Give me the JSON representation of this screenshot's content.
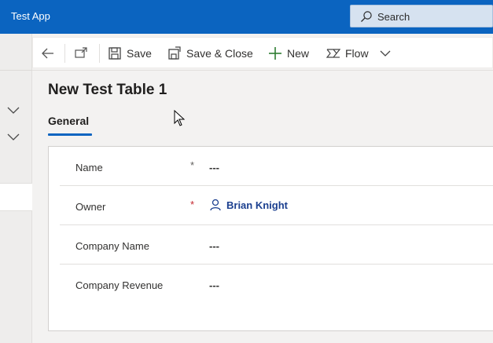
{
  "app": {
    "title": "Test App"
  },
  "search": {
    "label": "Search"
  },
  "commands": {
    "save": "Save",
    "save_close": "Save & Close",
    "new": "New",
    "flow": "Flow"
  },
  "form": {
    "title": "New Test Table 1",
    "tabs": [
      {
        "label": "General"
      }
    ],
    "fields": [
      {
        "label": "Name",
        "required_marker": "*",
        "value": "---"
      },
      {
        "label": "Owner",
        "required_marker": "*",
        "value": "Brian Knight"
      },
      {
        "label": "Company Name",
        "required_marker": "",
        "value": "---"
      },
      {
        "label": "Company Revenue",
        "required_marker": "",
        "value": "---"
      }
    ]
  },
  "colors": {
    "brand": "#0b64c0",
    "required_red": "#c4262e",
    "link": "#1b3f8f"
  }
}
